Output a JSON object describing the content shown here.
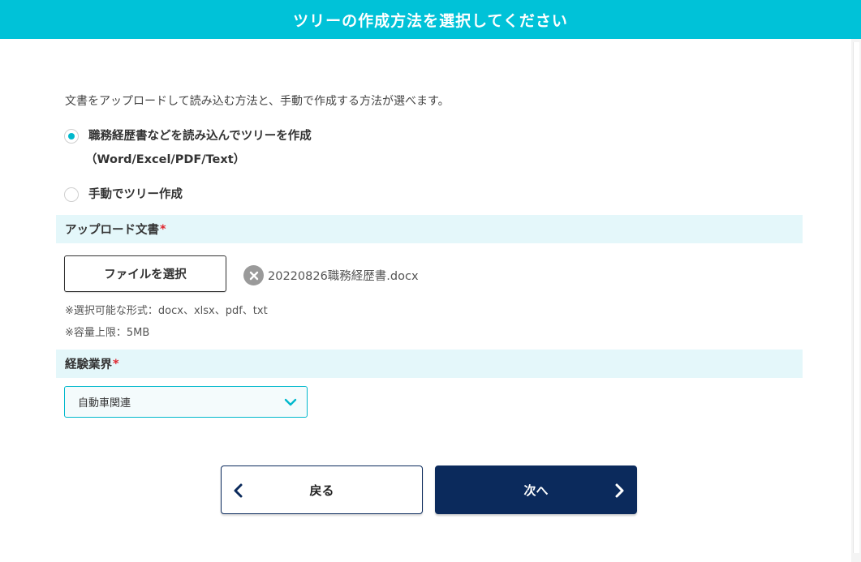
{
  "header": {
    "title": "ツリーの作成方法を選択してください"
  },
  "description": "文書をアップロードして読み込む方法と、手動で作成する方法が選べます。",
  "method_options": [
    {
      "label": "職務経歴書などを読み込んでツリーを作成",
      "sublabel": "（Word/Excel/PDF/Text）",
      "selected": true
    },
    {
      "label": "手動でツリー作成",
      "selected": false
    }
  ],
  "upload_section": {
    "label": "アップロード文書",
    "required_mark": "*",
    "file_button_label": "ファイルを選択",
    "file_name": "20220826職務経歴書.docx",
    "note_formats": "※選択可能な形式：docx、xlsx、pdf、txt",
    "note_size": "※容量上限：5MB"
  },
  "industry_section": {
    "label": "経験業界",
    "required_mark": "*",
    "selected_value": "自動車関連"
  },
  "navigation": {
    "back_label": "戻る",
    "next_label": "次へ"
  },
  "colors": {
    "header_bg": "#00c2d8",
    "accent": "#00b8cc",
    "section_bg": "#e4f7fa",
    "primary_button": "#0b2a5c",
    "required": "#e0262e"
  }
}
